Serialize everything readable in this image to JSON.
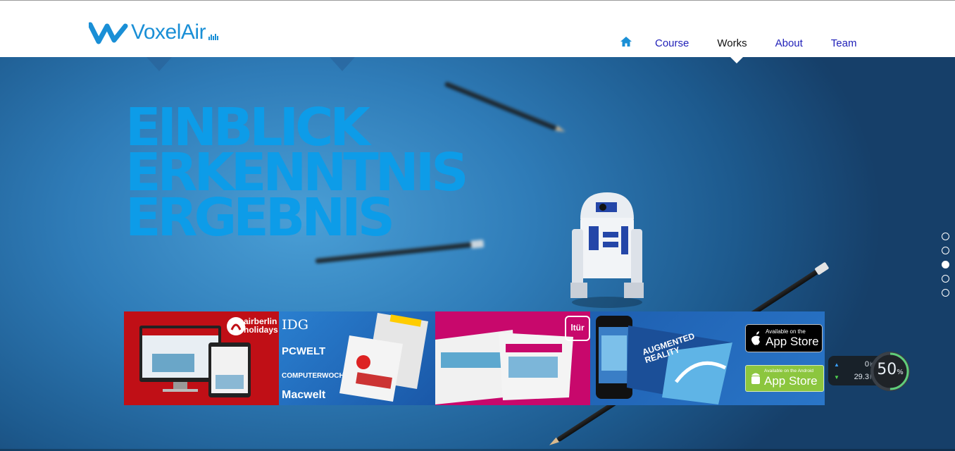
{
  "brand": {
    "name": "VoxelAir",
    "color": "#1a8fd6"
  },
  "nav": {
    "home_icon": "home-icon",
    "items": [
      {
        "label": "Course"
      },
      {
        "label": "Works",
        "active": true
      },
      {
        "label": "About"
      },
      {
        "label": "Team"
      }
    ]
  },
  "hero": {
    "headline": [
      "EINBLICK",
      "ERKENNTNIS",
      "ERGEBNIS"
    ],
    "headline_color": "#0d9ce8"
  },
  "portfolio": {
    "airberlin": {
      "line1": "airberlin",
      "line2": "holidays"
    },
    "idg": {
      "logo": "IDG",
      "publications": [
        "PCWELT",
        "COMPUTERWOCHE",
        "Macwelt"
      ]
    },
    "ltur": {
      "logo": "ltür"
    },
    "ar": {
      "book_title": "AUGMENTED REALITY",
      "apple_badge_small": "Available on the",
      "apple_badge_big": "App Store",
      "android_badge_small": "Available on the Android",
      "android_badge_big": "App Store"
    }
  },
  "slider": {
    "dots": 5,
    "active_index": 2
  },
  "speed_widget": {
    "upload_value": "0",
    "download_value": "29.3",
    "unit": "K/s",
    "percent": "50",
    "percent_sign": "%"
  }
}
